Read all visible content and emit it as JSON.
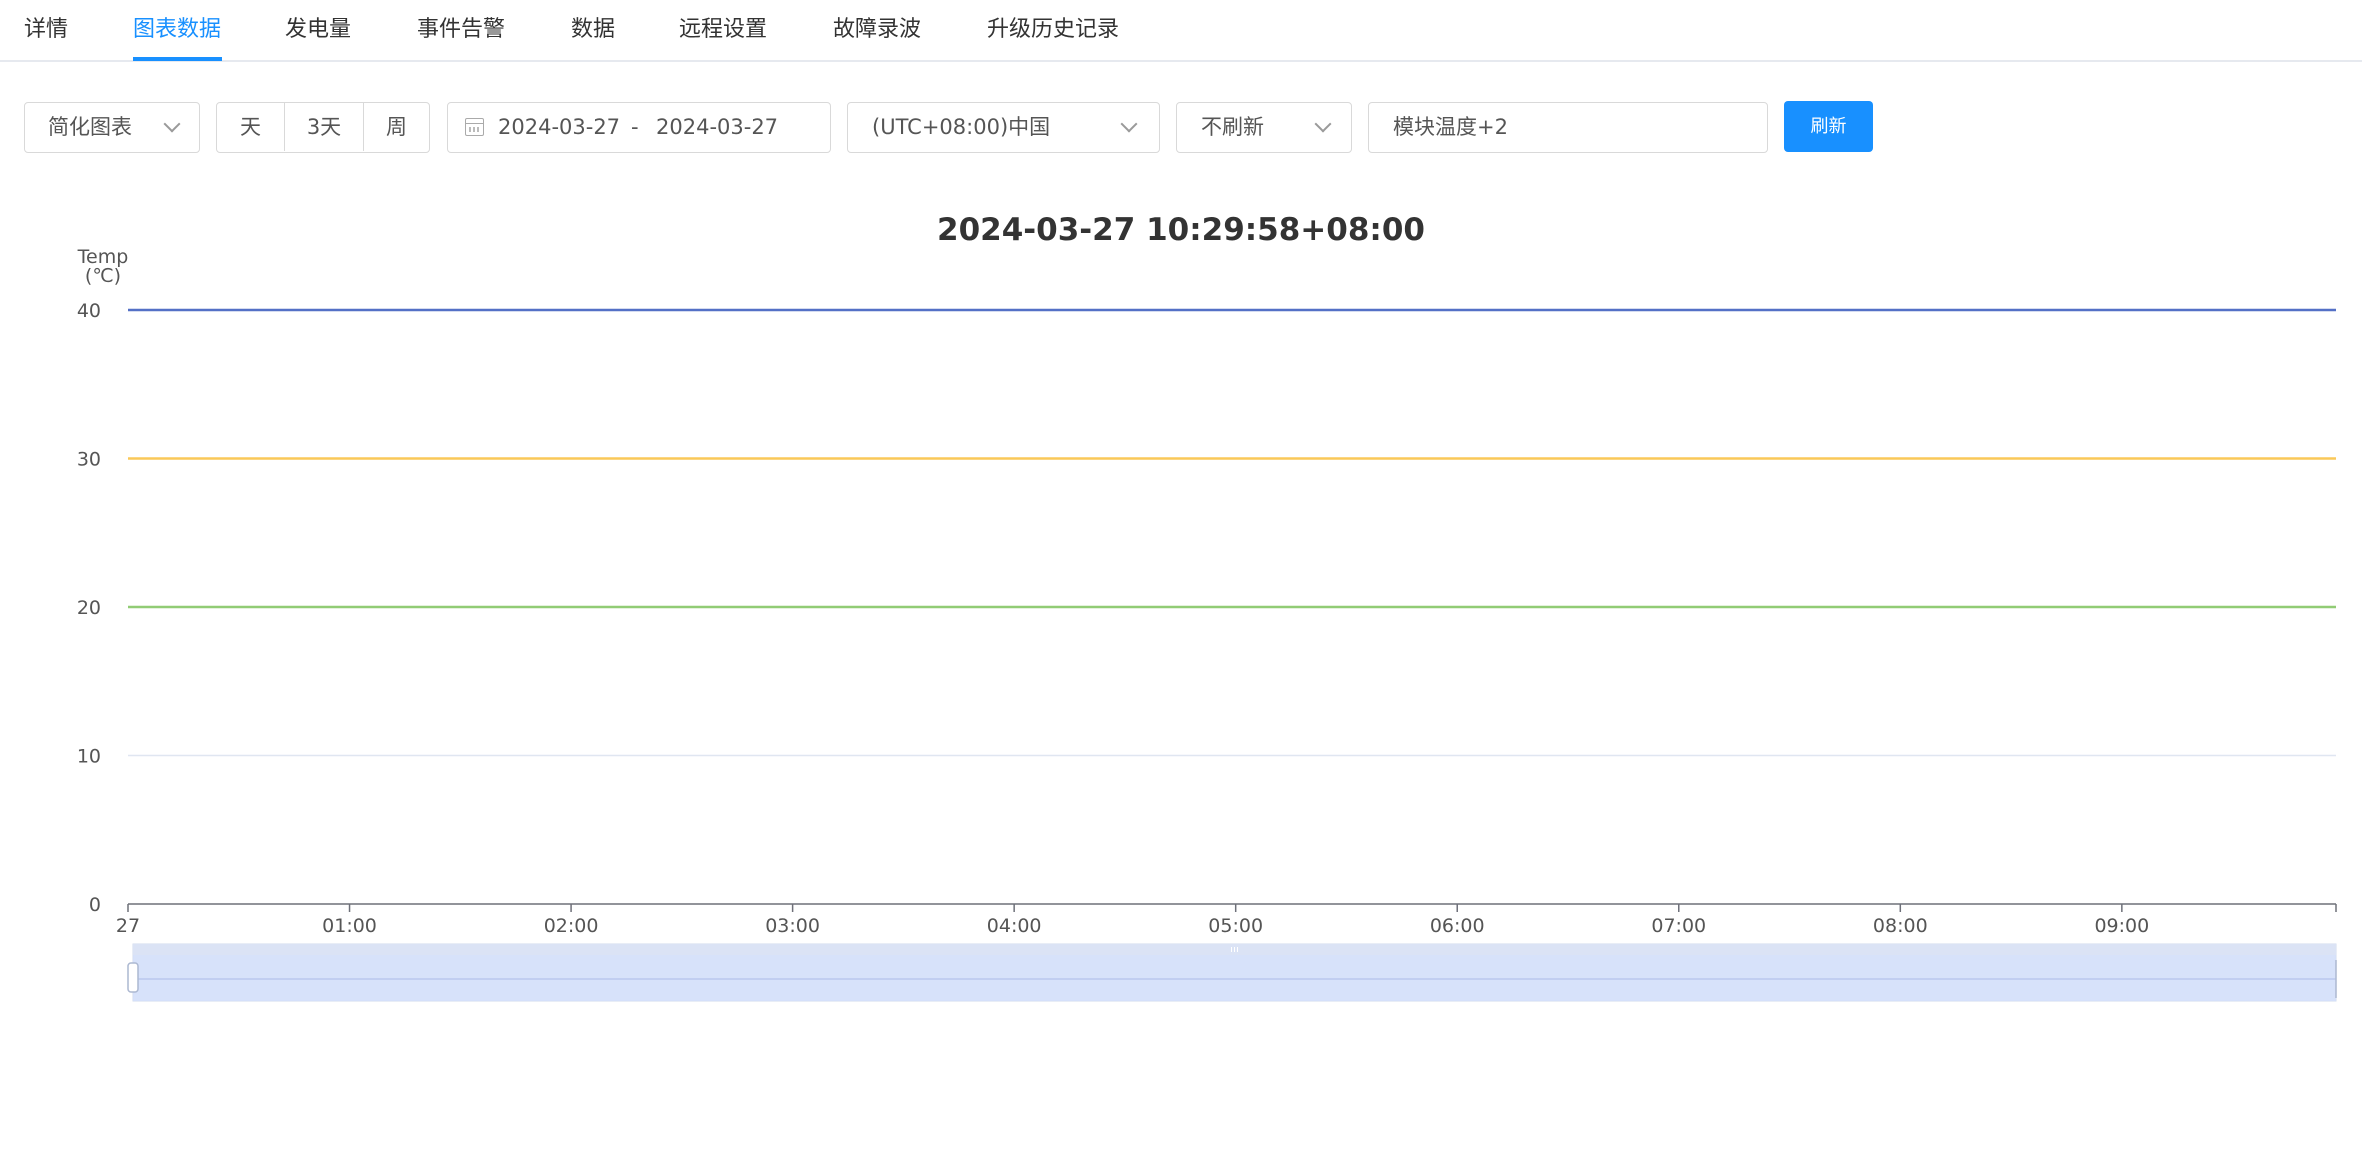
{
  "tabs": [
    {
      "label": "详情",
      "active": false
    },
    {
      "label": "图表数据",
      "active": true
    },
    {
      "label": "发电量",
      "active": false
    },
    {
      "label": "事件告警",
      "active": false
    },
    {
      "label": "数据",
      "active": false
    },
    {
      "label": "远程设置",
      "active": false
    },
    {
      "label": "故障录波",
      "active": false
    },
    {
      "label": "升级历史记录",
      "active": false
    }
  ],
  "toolbar": {
    "chart_type": "简化图表",
    "ranges": [
      "天",
      "3天",
      "周"
    ],
    "date_start": "2024-03-27",
    "date_separator": "-",
    "date_end": "2024-03-27",
    "timezone": "(UTC+08:00)中国",
    "refresh_mode": "不刷新",
    "metric": "模块温度+2",
    "refresh_button": "刷新"
  },
  "colors": {
    "accent": "#1890ff",
    "series": [
      "#5470c6",
      "#fac858",
      "#91cc75"
    ]
  },
  "chart_data": {
    "type": "line",
    "title": "2024-03-27 10:29:58+08:00",
    "ylabel": "Temp",
    "yunit": "(℃)",
    "ylim": [
      0,
      40
    ],
    "yticks": [
      0,
      10,
      20,
      30,
      40
    ],
    "xticks": [
      "27",
      "01:00",
      "02:00",
      "03:00",
      "04:00",
      "05:00",
      "06:00",
      "07:00",
      "08:00",
      "09:00"
    ],
    "xlim": [
      "00:00",
      "09:58"
    ],
    "grid": true,
    "series": [
      {
        "x": [
          "00:00",
          "09:58"
        ],
        "values": [
          40,
          40
        ],
        "color": "#5470c6"
      },
      {
        "x": [
          "00:00",
          "09:58"
        ],
        "values": [
          30,
          30
        ],
        "color": "#fac858"
      },
      {
        "x": [
          "00:00",
          "09:58"
        ],
        "values": [
          20,
          20
        ],
        "color": "#91cc75"
      }
    ],
    "zoom_slider": {
      "start": 0,
      "end": 100
    }
  }
}
